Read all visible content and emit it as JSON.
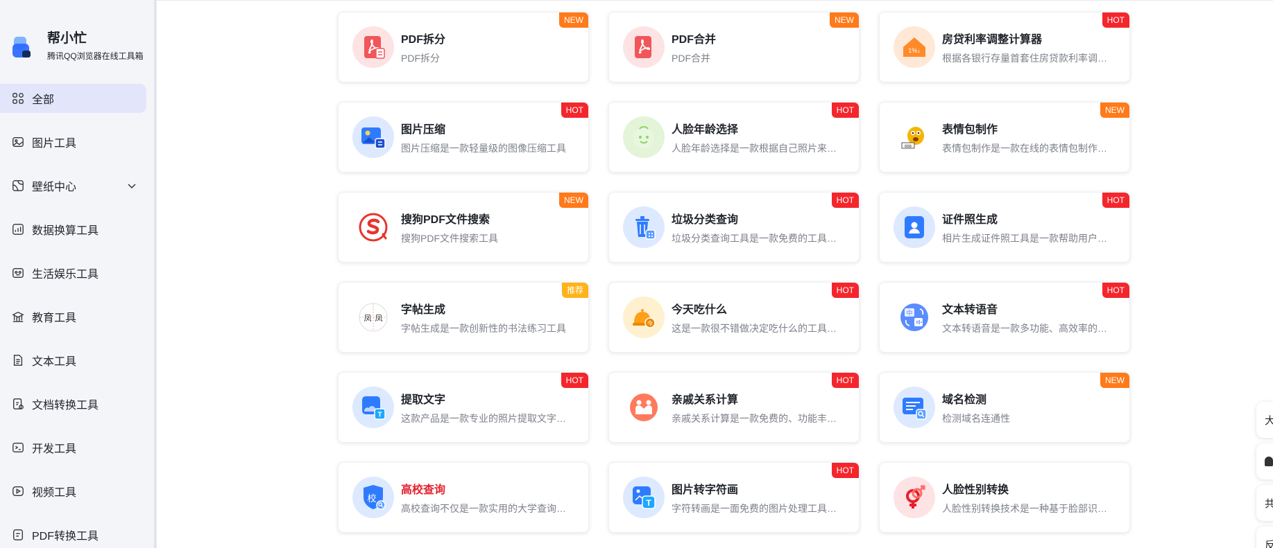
{
  "app": {
    "name": "帮小忙",
    "subtitle": "腾讯QQ浏览器在线工具箱"
  },
  "sidebar": {
    "items": [
      {
        "label": "全部",
        "icon": "grid-icon",
        "active": true
      },
      {
        "label": "图片工具",
        "icon": "image-icon"
      },
      {
        "label": "壁纸中心",
        "icon": "wallpaper-icon",
        "expandable": true
      },
      {
        "label": "数据换算工具",
        "icon": "chart-icon"
      },
      {
        "label": "生活娱乐工具",
        "icon": "entertainment-icon"
      },
      {
        "label": "教育工具",
        "icon": "education-icon"
      },
      {
        "label": "文本工具",
        "icon": "text-icon"
      },
      {
        "label": "文档转换工具",
        "icon": "document-convert-icon"
      },
      {
        "label": "开发工具",
        "icon": "terminal-icon"
      },
      {
        "label": "视频工具",
        "icon": "video-icon"
      },
      {
        "label": "PDF转换工具",
        "icon": "pdf-convert-icon"
      }
    ]
  },
  "tools": [
    {
      "title": "PDF拆分",
      "desc": "PDF拆分",
      "badge": "NEW",
      "icon": "pdf-split-icon",
      "color": "#f0565a"
    },
    {
      "title": "PDF合并",
      "desc": "PDF合并",
      "badge": "NEW",
      "icon": "pdf-merge-icon",
      "color": "#f0565a"
    },
    {
      "title": "房贷利率调整计算器",
      "desc": "根据各银行存量首套住房贷款利率调整计算",
      "badge": "HOT",
      "icon": "house-rate-icon",
      "color": "#ff8a2a"
    },
    {
      "title": "图片压缩",
      "desc": "图片压缩是一款轻量级的图像压缩工具",
      "badge": "HOT",
      "icon": "image-compress-icon",
      "color": "#2f7bff"
    },
    {
      "title": "人脸年龄选择",
      "desc": "人脸年龄选择是一款根据自己照片来预测年龄",
      "badge": "HOT",
      "icon": "baby-face-icon",
      "color": "#8ad46a"
    },
    {
      "title": "表情包制作",
      "desc": "表情包制作是一款在线的表情包制作工具",
      "badge": "NEW",
      "icon": "emoji-maker-icon",
      "color": "#f5b400"
    },
    {
      "title": "搜狗PDF文件搜索",
      "desc": "搜狗PDF文件搜索工具",
      "badge": "NEW",
      "icon": "sogou-icon",
      "color": "#e8342c"
    },
    {
      "title": "垃圾分类查询",
      "desc": "垃圾分类查询工具是一款免费的工具软件",
      "badge": "HOT",
      "icon": "trash-icon",
      "color": "#2f7bff"
    },
    {
      "title": "证件照生成",
      "desc": "相片生成证件照工具是一款帮助用户生成证件照",
      "badge": "HOT",
      "icon": "id-photo-icon",
      "color": "#2f7bff"
    },
    {
      "title": "字帖生成",
      "desc": "字帖生成是一款创新性的书法练习工具",
      "badge": "推荐",
      "icon": "copybook-icon",
      "color": "#e0463a"
    },
    {
      "title": "今天吃什么",
      "desc": "这是一款很不错做决定吃什么的工具软件",
      "badge": "HOT",
      "icon": "food-bell-icon",
      "color": "#ff9f1a"
    },
    {
      "title": "文本转语音",
      "desc": "文本转语音是一款多功能、高效率的工具",
      "badge": "HOT",
      "icon": "text-to-speech-icon",
      "color": "#5a8cff"
    },
    {
      "title": "提取文字",
      "desc": "这款产品是一款专业的照片提取文字工具",
      "badge": "HOT",
      "icon": "extract-text-icon",
      "color": "#2f7bff"
    },
    {
      "title": "亲戚关系计算",
      "desc": "亲戚关系计算是一款免费的、功能丰富的工具",
      "badge": "HOT",
      "icon": "relatives-icon",
      "color": "#ff7a5c"
    },
    {
      "title": "域名检测",
      "desc": "检测域名连通性",
      "badge": "NEW",
      "icon": "domain-check-icon",
      "color": "#2f7bff"
    },
    {
      "title": "高校查询",
      "desc": "高校查询不仅是一款实用的大学查询工具",
      "badge": "",
      "icon": "school-icon",
      "color": "#2f7bff",
      "red": true
    },
    {
      "title": "图片转字符画",
      "desc": "字符转画是一面免费的图片处理工具软件",
      "badge": "HOT",
      "icon": "image-to-ascii-icon",
      "color": "#2f7bff"
    },
    {
      "title": "人脸性别转换",
      "desc": "人脸性别转换技术是一种基于脸部识别技术",
      "badge": "",
      "icon": "gender-icon",
      "color": "#e5202e"
    }
  ],
  "floating": [
    {
      "label": "大",
      "icon": "font-size-icon"
    },
    {
      "label": "",
      "icon": "bell-icon"
    },
    {
      "label": "共",
      "icon": "share-icon"
    },
    {
      "label": "反",
      "icon": "feedback-icon"
    }
  ]
}
